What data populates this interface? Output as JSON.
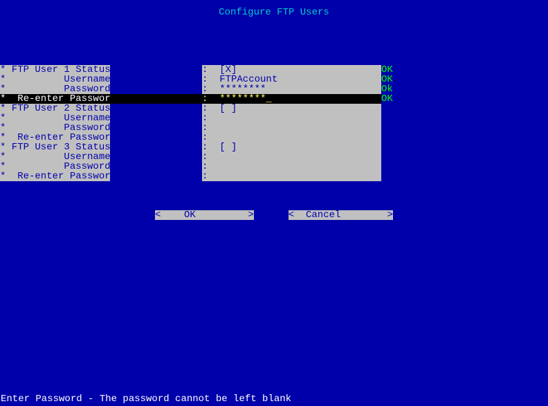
{
  "header": {
    "title": "Configure FTP Users"
  },
  "rows": [
    {
      "label": "* FTP User 1 Status   ",
      "value": ":  [X]",
      "status": "OK",
      "hl": false
    },
    {
      "label": "*          Username   ",
      "value": ":  FTPAccount",
      "status": "OK",
      "hl": false
    },
    {
      "label": "*          Password   ",
      "value": ":  ********",
      "status": "Ok",
      "hl": false
    },
    {
      "label": "*  Re-enter Password  ",
      "value": ":  ********_",
      "status": "OK",
      "hl": true
    },
    {
      "label": "* FTP User 2 Status   ",
      "value": ":  [ ]",
      "status": "",
      "hl": false
    },
    {
      "label": "*          Username   ",
      "value": ":",
      "status": "",
      "hl": false
    },
    {
      "label": "*          Password   ",
      "value": ":",
      "status": "",
      "hl": false
    },
    {
      "label": "*  Re-enter Password  ",
      "value": ":",
      "status": "",
      "hl": false
    },
    {
      "label": "* FTP User 3 Status   ",
      "value": ":  [ ]",
      "status": "",
      "hl": false
    },
    {
      "label": "*          Username   ",
      "value": ":",
      "status": "",
      "hl": false
    },
    {
      "label": "*          Password   ",
      "value": ":",
      "status": "",
      "hl": false
    },
    {
      "label": "*  Re-enter Password  ",
      "value": ":",
      "status": "",
      "hl": false
    }
  ],
  "buttons": {
    "ok": "<    OK         >",
    "cancel": "<  Cancel        >"
  },
  "footer": {
    "hint": "Enter Password - The password cannot be left blank"
  }
}
